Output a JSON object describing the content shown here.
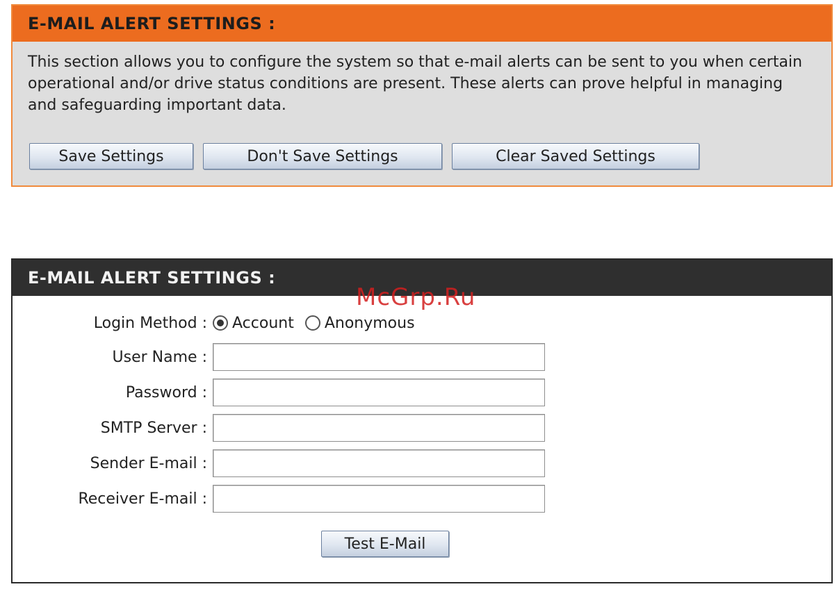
{
  "top_panel": {
    "title": "E-MAIL ALERT SETTINGS :",
    "description": "This section allows you to configure the system so that e-mail alerts can be sent to you when certain operational and/or drive status conditions are present. These alerts can prove helpful in managing and safeguarding important data.",
    "buttons": {
      "save": "Save Settings",
      "dont_save": "Don't Save Settings",
      "clear": "Clear Saved Settings"
    }
  },
  "bottom_panel": {
    "title": "E-MAIL ALERT SETTINGS :",
    "watermark": "McGrp.Ru",
    "login_method": {
      "label": "Login Method :",
      "options": [
        "Account",
        "Anonymous"
      ],
      "selected": "Account"
    },
    "fields": {
      "user_name": {
        "label": "User Name :",
        "value": ""
      },
      "password": {
        "label": "Password :",
        "value": ""
      },
      "smtp_server": {
        "label": "SMTP Server :",
        "value": ""
      },
      "sender_email": {
        "label": "Sender E-mail :",
        "value": ""
      },
      "receiver_email": {
        "label": "Receiver E-mail :",
        "value": ""
      }
    },
    "test_button": "Test E-Mail"
  },
  "colors": {
    "top_header_bg": "#ec6c1f",
    "top_panel_bg": "#dedede",
    "bottom_header_bg": "#2f2f2f",
    "watermark": "#d21e1e"
  }
}
